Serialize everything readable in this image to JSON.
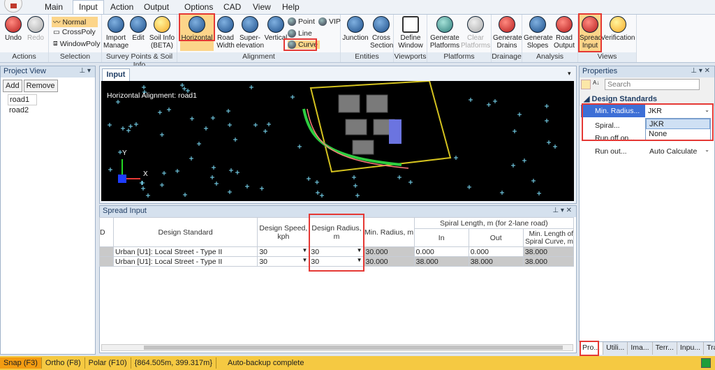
{
  "menu": {
    "tabs": [
      "Main",
      "Input",
      "Action",
      "Output",
      "Options",
      "CAD",
      "View",
      "Help"
    ]
  },
  "ribbon": {
    "actions": {
      "undo": "Undo",
      "redo": "Redo",
      "label": "Actions"
    },
    "selection": {
      "normal": "Normal",
      "crosspoly": "CrossPoly",
      "windowpoly": "WindowPoly",
      "label": "Selection"
    },
    "survey": {
      "import": [
        "Import",
        "Manage"
      ],
      "edit": "Edit",
      "soil": [
        "Soil Info",
        "(BETA)"
      ],
      "label": "Survey Points & Soil Info"
    },
    "alignment": {
      "horizontal": "Horizontal",
      "road_width": [
        "Road",
        "Width"
      ],
      "super": [
        "Super-",
        "elevation"
      ],
      "vertical": "Vertical",
      "point": "Point",
      "vip": "VIP",
      "line": "Line",
      "curve": "Curve",
      "label": "Alignment"
    },
    "entities": {
      "junction": "Junction",
      "cross": [
        "Cross",
        "Section"
      ],
      "label": "Entities"
    },
    "viewports": {
      "define": [
        "Define",
        "Window"
      ],
      "label": "Viewports"
    },
    "platforms": {
      "generate": [
        "Generate",
        "Platforms"
      ],
      "clear": [
        "Clear",
        "Platforms"
      ],
      "label": "Platforms"
    },
    "drainage": {
      "generate": [
        "Generate",
        "Drains"
      ],
      "label": "Drainage"
    },
    "analysis": {
      "slopes": [
        "Generate",
        "Slopes"
      ],
      "road": [
        "Road",
        "Output"
      ],
      "label": "Analysis"
    },
    "views": {
      "spread": [
        "Spread",
        "Input"
      ],
      "verification": "Verification",
      "label": "Views"
    }
  },
  "project_view": {
    "title": "Project View",
    "add": "Add",
    "remove": "Remove",
    "items": [
      "road1",
      "road2"
    ]
  },
  "input_tab": {
    "title": "Input",
    "viewport_label": "Horizontal Alignment: road1"
  },
  "spread": {
    "title": "Spread Input",
    "headers": {
      "id": "D",
      "standard": "Design Standard",
      "speed": "Design Speed, kph",
      "radius": "Design Radius, m",
      "min_radius": "Min. Radius, m",
      "spiral_group": "Spiral Length, m (for 2-lane road)",
      "in": "In",
      "out": "Out",
      "min_len": "Min. Length of Spiral Curve, m"
    },
    "rows": [
      {
        "standard": "Urban [U1]: Local Street - Type II",
        "speed": "30",
        "radius": "30",
        "min_radius": "30.000",
        "in": "0.000",
        "out": "0.000",
        "min_len": "38.000"
      },
      {
        "standard": "Urban [U1]: Local Street - Type II",
        "speed": "30",
        "radius": "30",
        "min_radius": "30.000",
        "in": "38.000",
        "out": "38.000",
        "min_len": "38.000"
      }
    ]
  },
  "properties": {
    "title": "Properties",
    "search_placeholder": "Search",
    "section": "Design Standards",
    "rows": [
      {
        "label": "Min. Radius...",
        "value": "JKR"
      },
      {
        "label": "Spiral...",
        "value": ""
      },
      {
        "label": "Run off on...",
        "value": ""
      },
      {
        "label": "Run out...",
        "value": "Auto Calculate"
      }
    ],
    "dropdown_options": [
      "JKR",
      "None"
    ]
  },
  "bottom_tabs": [
    "Pro...",
    "Utili...",
    "Ima...",
    "Terr...",
    "Inpu...",
    "Traci..."
  ],
  "status": {
    "snap": "Snap (F3)",
    "ortho": "Ortho (F8)",
    "polar": "Polar (F10)",
    "coords": "{864.505m, 399.317m}",
    "message": "Auto-backup complete"
  }
}
